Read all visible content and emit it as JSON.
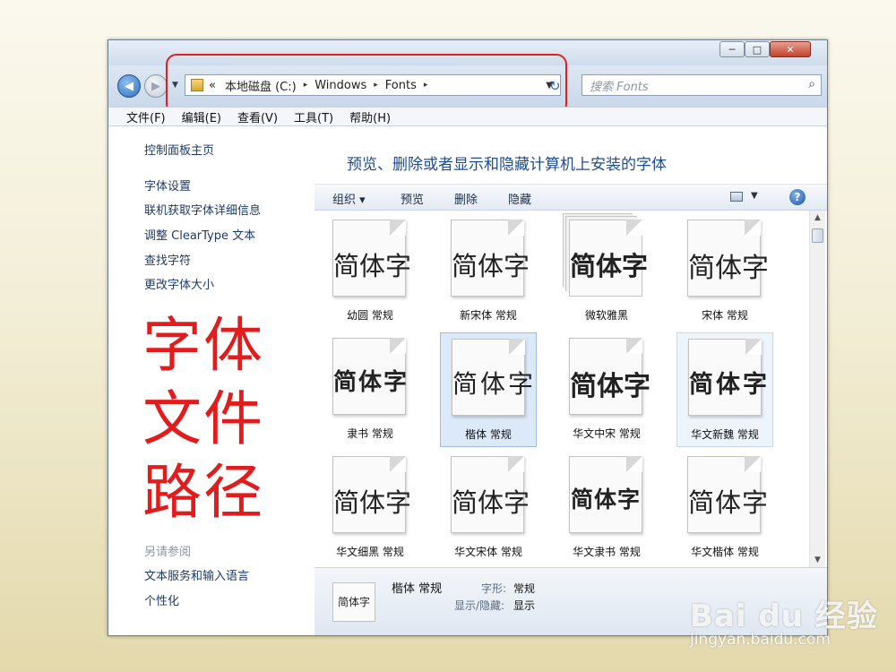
{
  "window": {
    "controls": {
      "minimize": "─",
      "maximize": "□",
      "close": "✕"
    }
  },
  "nav": {
    "back": "◀",
    "forward": "▶",
    "dropdown": "▼",
    "breadcrumb": {
      "overflow": "«",
      "items": [
        "本地磁盘 (C:)",
        "Windows",
        "Fonts"
      ],
      "separator": "▸",
      "dropdown": "▼"
    },
    "refresh": "↻",
    "search_placeholder": "搜索 Fonts",
    "search_icon": "⌕"
  },
  "menubar": {
    "items": [
      "文件(F)",
      "编辑(E)",
      "查看(V)",
      "工具(T)",
      "帮助(H)"
    ]
  },
  "sidebar": {
    "home": "控制面板主页",
    "links": [
      "字体设置",
      "联机获取字体详细信息",
      "调整 ClearType 文本",
      "查找字符",
      "更改字体大小"
    ],
    "annotation_lines": [
      "字体",
      "文件",
      "路径"
    ],
    "see_also_title": "另请参阅",
    "see_also": [
      "文本服务和输入语言",
      "个性化"
    ]
  },
  "main": {
    "heading": "预览、删除或者显示和隐藏计算机上安装的字体",
    "commands": [
      "组织 ▾",
      "预览",
      "删除",
      "隐藏"
    ],
    "help": "?",
    "view_dropdown": "▼",
    "sample_text": "简体字",
    "fonts": [
      {
        "label": "幼圆 常规"
      },
      {
        "label": "新宋体 常规"
      },
      {
        "label": "微软雅黑"
      },
      {
        "label": "宋体 常规"
      },
      {
        "label": "隶书 常规"
      },
      {
        "label": "楷体 常规"
      },
      {
        "label": "华文中宋 常规"
      },
      {
        "label": "华文新魏 常规"
      },
      {
        "label": "华文细黑 常规"
      },
      {
        "label": "华文宋体 常规"
      },
      {
        "label": "华文隶书 常规"
      },
      {
        "label": "华文楷体 常规"
      }
    ],
    "scroll_up": "▲",
    "scroll_down": "▼"
  },
  "details": {
    "name": "楷体 常规",
    "style_key": "字形:",
    "style_value": "常规",
    "visibility_key": "显示/隐藏:",
    "visibility_value": "显示"
  },
  "watermark": {
    "logo": "Bai du 经验",
    "url": "jingyan.baidu.com"
  },
  "colors": {
    "highlight": "#e01f1f",
    "annotation": "#e21c1c",
    "heading": "#1e4c92",
    "selection": "#dce9f8"
  }
}
